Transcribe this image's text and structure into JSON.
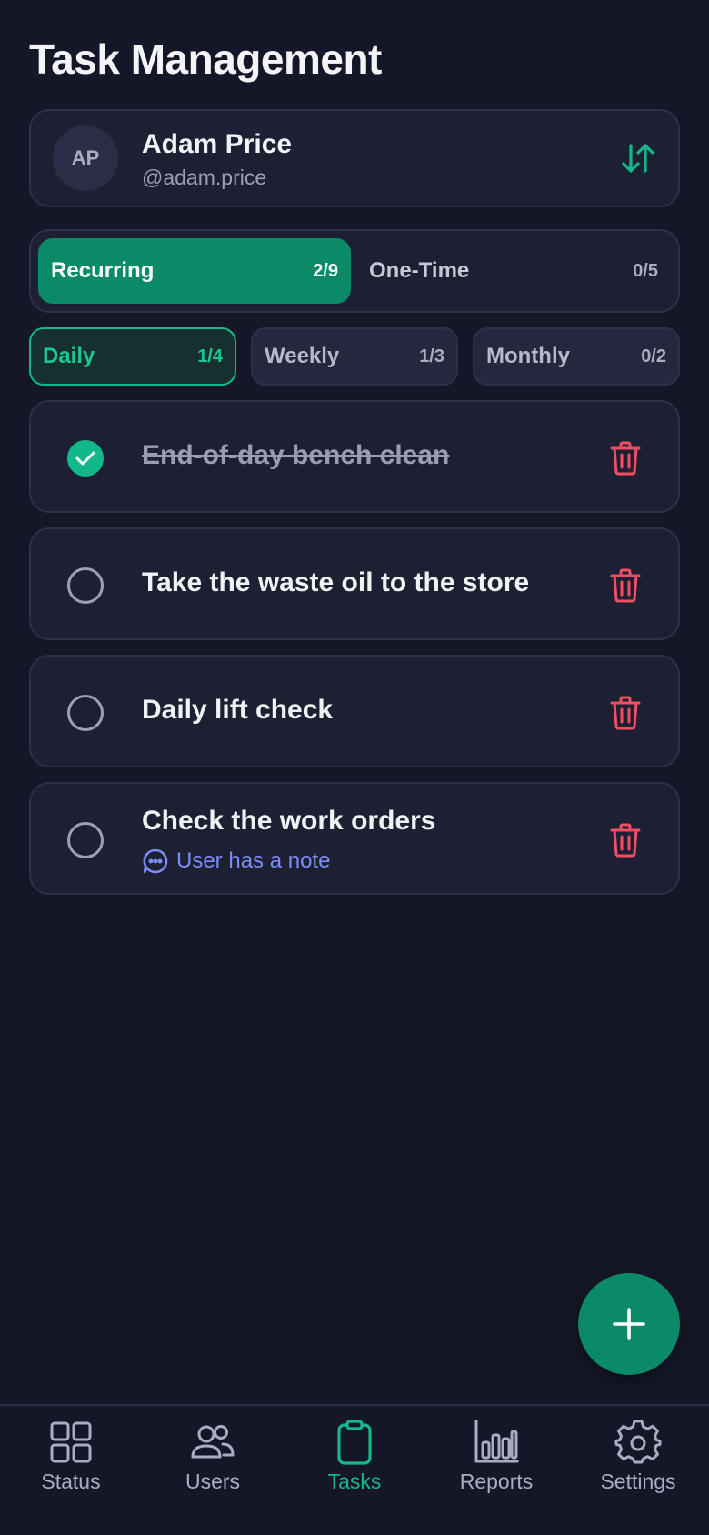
{
  "page": {
    "title": "Task Management"
  },
  "user": {
    "initials": "AP",
    "name": "Adam Price",
    "handle": "@adam.price"
  },
  "segments": [
    {
      "label": "Recurring",
      "count": "2/9",
      "active": true
    },
    {
      "label": "One-Time",
      "count": "0/5",
      "active": false
    }
  ],
  "periods": [
    {
      "label": "Daily",
      "count": "1/4",
      "active": true
    },
    {
      "label": "Weekly",
      "count": "1/3",
      "active": false
    },
    {
      "label": "Monthly",
      "count": "0/2",
      "active": false
    }
  ],
  "tasks": [
    {
      "text": "End-of-day bench clean",
      "done": true
    },
    {
      "text": "Take the waste oil to the store",
      "done": false
    },
    {
      "text": "Daily lift check",
      "done": false
    },
    {
      "text": "Check the work orders",
      "done": false,
      "note": "User has a note"
    }
  ],
  "nav": [
    {
      "label": "Status",
      "icon": "grid-icon",
      "active": false
    },
    {
      "label": "Users",
      "icon": "users-icon",
      "active": false
    },
    {
      "label": "Tasks",
      "icon": "clipboard-icon",
      "active": true
    },
    {
      "label": "Reports",
      "icon": "bar-chart-icon",
      "active": false
    },
    {
      "label": "Settings",
      "icon": "gear-icon",
      "active": false
    }
  ],
  "colors": {
    "background": "#151728",
    "card": "#1d1f33",
    "accent": "#0b8a68",
    "accent_bright": "#12b887",
    "danger": "#ef4f5f",
    "note": "#7c8cf8"
  }
}
